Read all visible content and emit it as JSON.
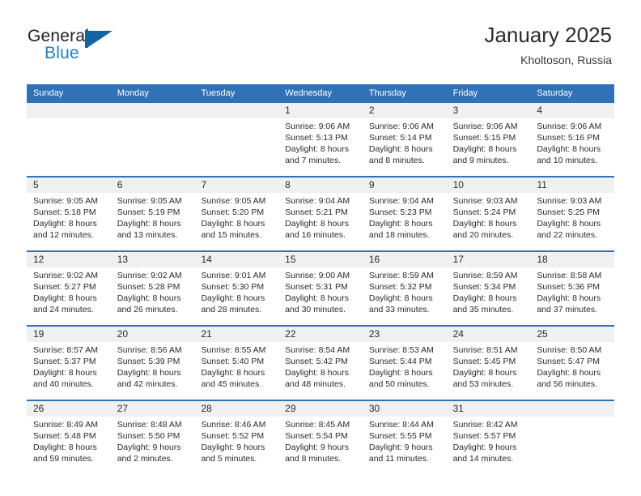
{
  "brand": {
    "name_part1": "General",
    "name_part2": "Blue",
    "logo_icon": "triangle-flag-icon",
    "accent_color": "#1f7fc4"
  },
  "header": {
    "title": "January 2025",
    "location": "Kholtoson, Russia"
  },
  "theme": {
    "header_blue": "#3071b8",
    "number_band": "#f0f0f0",
    "text": "#2b2b2b"
  },
  "weekday_headers": [
    "Sunday",
    "Monday",
    "Tuesday",
    "Wednesday",
    "Thursday",
    "Friday",
    "Saturday"
  ],
  "weeks": [
    {
      "numbers": [
        "",
        "",
        "",
        "1",
        "2",
        "3",
        "4"
      ],
      "cells": [
        {
          "empty": true,
          "l1": "",
          "l2": "",
          "l3": "",
          "l4": ""
        },
        {
          "empty": true,
          "l1": "",
          "l2": "",
          "l3": "",
          "l4": ""
        },
        {
          "empty": true,
          "l1": "",
          "l2": "",
          "l3": "",
          "l4": ""
        },
        {
          "empty": false,
          "l1": "Sunrise: 9:06 AM",
          "l2": "Sunset: 5:13 PM",
          "l3": "Daylight: 8 hours",
          "l4": "and 7 minutes."
        },
        {
          "empty": false,
          "l1": "Sunrise: 9:06 AM",
          "l2": "Sunset: 5:14 PM",
          "l3": "Daylight: 8 hours",
          "l4": "and 8 minutes."
        },
        {
          "empty": false,
          "l1": "Sunrise: 9:06 AM",
          "l2": "Sunset: 5:15 PM",
          "l3": "Daylight: 8 hours",
          "l4": "and 9 minutes."
        },
        {
          "empty": false,
          "l1": "Sunrise: 9:06 AM",
          "l2": "Sunset: 5:16 PM",
          "l3": "Daylight: 8 hours",
          "l4": "and 10 minutes."
        }
      ]
    },
    {
      "numbers": [
        "5",
        "6",
        "7",
        "8",
        "9",
        "10",
        "11"
      ],
      "cells": [
        {
          "empty": false,
          "l1": "Sunrise: 9:05 AM",
          "l2": "Sunset: 5:18 PM",
          "l3": "Daylight: 8 hours",
          "l4": "and 12 minutes."
        },
        {
          "empty": false,
          "l1": "Sunrise: 9:05 AM",
          "l2": "Sunset: 5:19 PM",
          "l3": "Daylight: 8 hours",
          "l4": "and 13 minutes."
        },
        {
          "empty": false,
          "l1": "Sunrise: 9:05 AM",
          "l2": "Sunset: 5:20 PM",
          "l3": "Daylight: 8 hours",
          "l4": "and 15 minutes."
        },
        {
          "empty": false,
          "l1": "Sunrise: 9:04 AM",
          "l2": "Sunset: 5:21 PM",
          "l3": "Daylight: 8 hours",
          "l4": "and 16 minutes."
        },
        {
          "empty": false,
          "l1": "Sunrise: 9:04 AM",
          "l2": "Sunset: 5:23 PM",
          "l3": "Daylight: 8 hours",
          "l4": "and 18 minutes."
        },
        {
          "empty": false,
          "l1": "Sunrise: 9:03 AM",
          "l2": "Sunset: 5:24 PM",
          "l3": "Daylight: 8 hours",
          "l4": "and 20 minutes."
        },
        {
          "empty": false,
          "l1": "Sunrise: 9:03 AM",
          "l2": "Sunset: 5:25 PM",
          "l3": "Daylight: 8 hours",
          "l4": "and 22 minutes."
        }
      ]
    },
    {
      "numbers": [
        "12",
        "13",
        "14",
        "15",
        "16",
        "17",
        "18"
      ],
      "cells": [
        {
          "empty": false,
          "l1": "Sunrise: 9:02 AM",
          "l2": "Sunset: 5:27 PM",
          "l3": "Daylight: 8 hours",
          "l4": "and 24 minutes."
        },
        {
          "empty": false,
          "l1": "Sunrise: 9:02 AM",
          "l2": "Sunset: 5:28 PM",
          "l3": "Daylight: 8 hours",
          "l4": "and 26 minutes."
        },
        {
          "empty": false,
          "l1": "Sunrise: 9:01 AM",
          "l2": "Sunset: 5:30 PM",
          "l3": "Daylight: 8 hours",
          "l4": "and 28 minutes."
        },
        {
          "empty": false,
          "l1": "Sunrise: 9:00 AM",
          "l2": "Sunset: 5:31 PM",
          "l3": "Daylight: 8 hours",
          "l4": "and 30 minutes."
        },
        {
          "empty": false,
          "l1": "Sunrise: 8:59 AM",
          "l2": "Sunset: 5:32 PM",
          "l3": "Daylight: 8 hours",
          "l4": "and 33 minutes."
        },
        {
          "empty": false,
          "l1": "Sunrise: 8:59 AM",
          "l2": "Sunset: 5:34 PM",
          "l3": "Daylight: 8 hours",
          "l4": "and 35 minutes."
        },
        {
          "empty": false,
          "l1": "Sunrise: 8:58 AM",
          "l2": "Sunset: 5:36 PM",
          "l3": "Daylight: 8 hours",
          "l4": "and 37 minutes."
        }
      ]
    },
    {
      "numbers": [
        "19",
        "20",
        "21",
        "22",
        "23",
        "24",
        "25"
      ],
      "cells": [
        {
          "empty": false,
          "l1": "Sunrise: 8:57 AM",
          "l2": "Sunset: 5:37 PM",
          "l3": "Daylight: 8 hours",
          "l4": "and 40 minutes."
        },
        {
          "empty": false,
          "l1": "Sunrise: 8:56 AM",
          "l2": "Sunset: 5:39 PM",
          "l3": "Daylight: 8 hours",
          "l4": "and 42 minutes."
        },
        {
          "empty": false,
          "l1": "Sunrise: 8:55 AM",
          "l2": "Sunset: 5:40 PM",
          "l3": "Daylight: 8 hours",
          "l4": "and 45 minutes."
        },
        {
          "empty": false,
          "l1": "Sunrise: 8:54 AM",
          "l2": "Sunset: 5:42 PM",
          "l3": "Daylight: 8 hours",
          "l4": "and 48 minutes."
        },
        {
          "empty": false,
          "l1": "Sunrise: 8:53 AM",
          "l2": "Sunset: 5:44 PM",
          "l3": "Daylight: 8 hours",
          "l4": "and 50 minutes."
        },
        {
          "empty": false,
          "l1": "Sunrise: 8:51 AM",
          "l2": "Sunset: 5:45 PM",
          "l3": "Daylight: 8 hours",
          "l4": "and 53 minutes."
        },
        {
          "empty": false,
          "l1": "Sunrise: 8:50 AM",
          "l2": "Sunset: 5:47 PM",
          "l3": "Daylight: 8 hours",
          "l4": "and 56 minutes."
        }
      ]
    },
    {
      "numbers": [
        "26",
        "27",
        "28",
        "29",
        "30",
        "31",
        ""
      ],
      "cells": [
        {
          "empty": false,
          "l1": "Sunrise: 8:49 AM",
          "l2": "Sunset: 5:48 PM",
          "l3": "Daylight: 8 hours",
          "l4": "and 59 minutes."
        },
        {
          "empty": false,
          "l1": "Sunrise: 8:48 AM",
          "l2": "Sunset: 5:50 PM",
          "l3": "Daylight: 9 hours",
          "l4": "and 2 minutes."
        },
        {
          "empty": false,
          "l1": "Sunrise: 8:46 AM",
          "l2": "Sunset: 5:52 PM",
          "l3": "Daylight: 9 hours",
          "l4": "and 5 minutes."
        },
        {
          "empty": false,
          "l1": "Sunrise: 8:45 AM",
          "l2": "Sunset: 5:54 PM",
          "l3": "Daylight: 9 hours",
          "l4": "and 8 minutes."
        },
        {
          "empty": false,
          "l1": "Sunrise: 8:44 AM",
          "l2": "Sunset: 5:55 PM",
          "l3": "Daylight: 9 hours",
          "l4": "and 11 minutes."
        },
        {
          "empty": false,
          "l1": "Sunrise: 8:42 AM",
          "l2": "Sunset: 5:57 PM",
          "l3": "Daylight: 9 hours",
          "l4": "and 14 minutes."
        },
        {
          "empty": true,
          "l1": "",
          "l2": "",
          "l3": "",
          "l4": ""
        }
      ]
    }
  ]
}
